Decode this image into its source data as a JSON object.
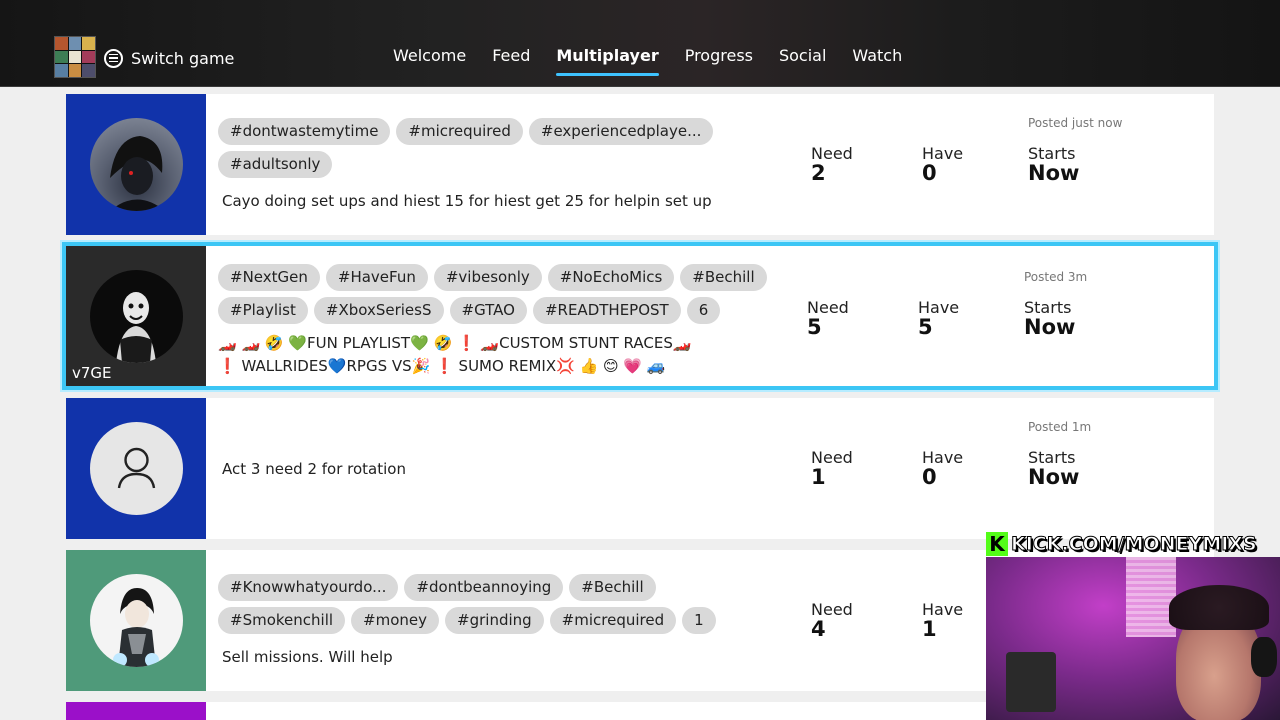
{
  "header": {
    "switch_game_label": "Switch game",
    "tabs": [
      {
        "label": "Welcome",
        "active": false
      },
      {
        "label": "Feed",
        "active": false
      },
      {
        "label": "Multiplayer",
        "active": true
      },
      {
        "label": "Progress",
        "active": false
      },
      {
        "label": "Social",
        "active": false
      },
      {
        "label": "Watch",
        "active": false
      }
    ]
  },
  "posts": [
    {
      "avatar_bg": "#1133aa",
      "gamertag": "",
      "tag_rows": [
        [
          "#dontwastemytime",
          "#micrequired",
          "#experiencedplaye..."
        ],
        [
          "#adultsonly"
        ]
      ],
      "description": [
        "Cayo doing set ups and hiest 15 for hiest get 25 for helpin set up"
      ],
      "need_label": "Need",
      "need": "2",
      "have_label": "Have",
      "have": "0",
      "starts_label": "Starts",
      "starts": "Now",
      "posted": "Posted just now"
    },
    {
      "avatar_bg": "#2a2a2a",
      "gamertag": "v7GE",
      "tag_rows": [
        [
          "#NextGen",
          "#HaveFun",
          "#vibesonly",
          "#NoEchoMics",
          "#Bechill"
        ],
        [
          "#Playlist",
          "#XboxSeriesS",
          "#GTAO",
          "#READTHEPOST",
          "6"
        ]
      ],
      "description": [
        "🏎️ 🏎️ 🤣 💚FUN PLAYLIST💚 🤣 ❗ 🏎️CUSTOM STUNT RACES🏎️",
        "❗ WALLRIDES💙RPGS VS🎉 ❗ SUMO REMIX💢 👍 😊 💗 🚙"
      ],
      "need_label": "Need",
      "need": "5",
      "have_label": "Have",
      "have": "5",
      "starts_label": "Starts",
      "starts": "Now",
      "posted": "Posted 3m"
    },
    {
      "avatar_bg": "#1133aa",
      "gamertag": "",
      "tag_rows": [],
      "description": [
        "Act 3 need 2 for rotation"
      ],
      "need_label": "Need",
      "need": "1",
      "have_label": "Have",
      "have": "0",
      "starts_label": "Starts",
      "starts": "Now",
      "posted": "Posted 1m"
    },
    {
      "avatar_bg": "#4f9a7a",
      "gamertag": "",
      "tag_rows": [
        [
          "#Knowwhatyourdo...",
          "#dontbeannoying",
          "#Bechill"
        ],
        [
          "#Smokenchill",
          "#money",
          "#grinding",
          "#micrequired",
          "1"
        ]
      ],
      "description": [
        "Sell missions. Will help"
      ],
      "need_label": "Need",
      "need": "4",
      "have_label": "Have",
      "have": "1",
      "starts_label": "",
      "starts": "",
      "posted": ""
    }
  ],
  "overlay": {
    "kick_letter": "K",
    "kick_text": "KICK.COM/MONEYMIXS",
    "kick_color": "#53fc18"
  },
  "colors": {
    "selected_border": "#3cc6f5",
    "tab_underline": "#3ec3ff",
    "next_post_bg": "#9b10c9"
  }
}
